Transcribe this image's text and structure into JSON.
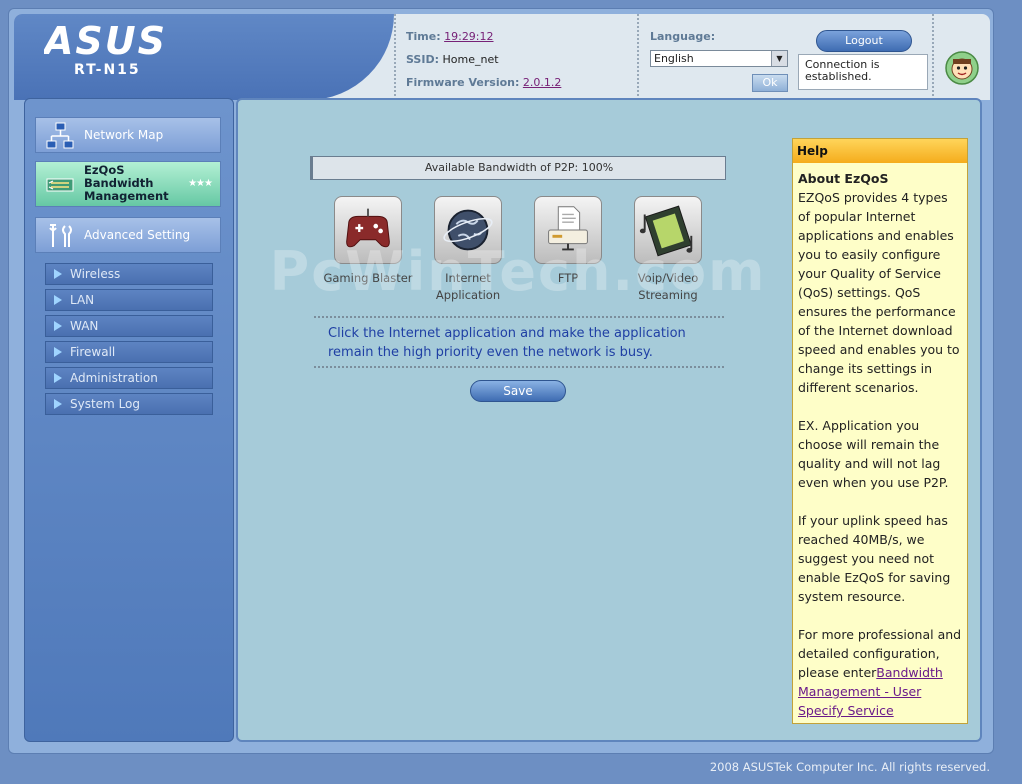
{
  "header": {
    "brand": "ASUS",
    "model": "RT-N15",
    "time_label": "Time:",
    "time_value": "19:29:12",
    "ssid_label": "SSID:",
    "ssid_value": "Home_net",
    "firmware_label": "Firmware Version:",
    "firmware_value": "2.0.1.2",
    "language_label": "Language:",
    "language_selected": "English",
    "ok_label": "Ok",
    "logout_label": "Logout",
    "connection_status": "Connection is established."
  },
  "sidebar": {
    "main_items": [
      {
        "label": "Network Map",
        "icon": "network-map-icon"
      },
      {
        "label": "EzQoS Bandwidth Management",
        "icon": "bandwidth-icon",
        "active": true
      },
      {
        "label": "Advanced Setting",
        "icon": "tools-icon"
      }
    ],
    "sub_items": [
      {
        "label": "Wireless"
      },
      {
        "label": "LAN"
      },
      {
        "label": "WAN"
      },
      {
        "label": "Firewall"
      },
      {
        "label": "Administration"
      },
      {
        "label": "System Log"
      }
    ]
  },
  "main": {
    "bandwidth_text": "Available Bandwidth of P2P: 100%",
    "apps": [
      {
        "label": "Gaming Blaster",
        "icon": "gamepad-icon"
      },
      {
        "label": "Internet Application",
        "icon": "globe-icon"
      },
      {
        "label": "FTP",
        "icon": "ftp-icon"
      },
      {
        "label": "Voip/Video Streaming",
        "icon": "film-icon"
      }
    ],
    "description": "Click the Internet application and make the application remain the high priority even the network is busy.",
    "save_label": "Save",
    "watermark": "PcWinTech.com"
  },
  "help": {
    "title": "Help",
    "heading": "About EzQoS",
    "para1": "EZQoS provides 4 types of popular Internet applications and enables you to easily configure your Quality of Service (QoS) settings. QoS ensures the performance of the Internet download speed and enables you to change its settings in different scenarios.",
    "para2": "EX. Application you choose will remain the quality and will not lag even when you use P2P.",
    "para3": "If your uplink speed has reached 40MB/s, we suggest you need not enable EzQoS for saving system resource.",
    "para4_prefix": "For more professional and detailed configuration, please enter",
    "para4_link": "Bandwidth Management - User Specify Service"
  },
  "footer": {
    "copyright": "2008 ASUSTek Computer Inc. All rights reserved."
  }
}
